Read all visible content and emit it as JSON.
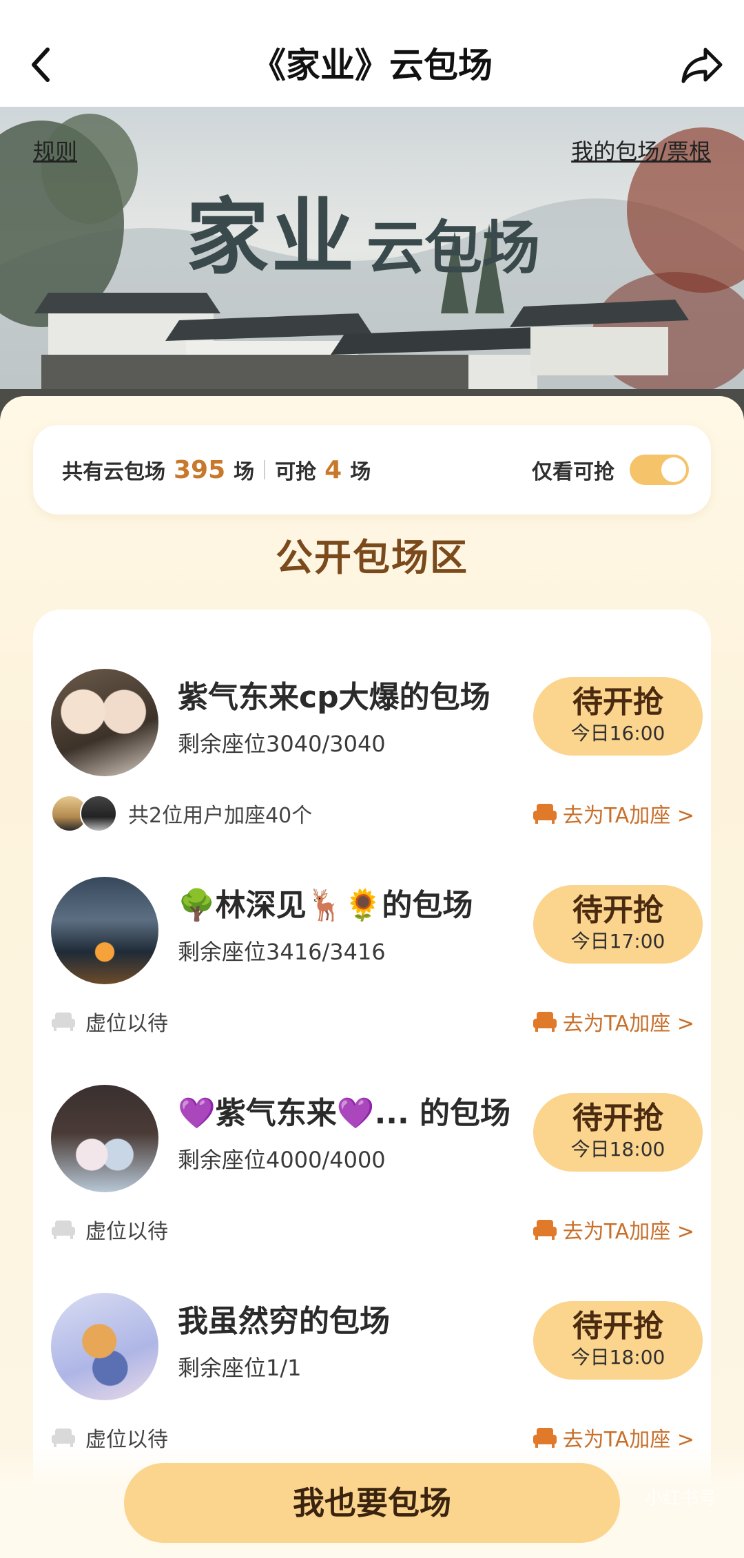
{
  "header": {
    "title": "《家业》云包场"
  },
  "banner": {
    "rules_link": "规则",
    "my_link": "我的包场/票根",
    "title_big": "家业",
    "title_small": "云包场"
  },
  "summary": {
    "total_label": "共有云包场",
    "total_count": "395",
    "total_unit": "场",
    "available_label": "可抢",
    "available_count": "4",
    "available_unit": "场",
    "filter_label": "仅看可抢",
    "filter_on": true
  },
  "section": {
    "title": "公开包场区"
  },
  "items": [
    {
      "title": "紫气东来cp大爆的包场",
      "seats": "剩余座位3040/3040",
      "button_label": "待开抢",
      "time": "今日16:00",
      "footer_left": "共2位用户加座40个",
      "footer_right": "去为TA加座 >"
    },
    {
      "title": "🌳林深见🦌🌻的包场",
      "seats": "剩余座位3416/3416",
      "button_label": "待开抢",
      "time": "今日17:00",
      "footer_left": "虚位以待",
      "footer_right": "去为TA加座 >"
    },
    {
      "title": "💜紫气东来💜...  的包场",
      "seats": "剩余座位4000/4000",
      "button_label": "待开抢",
      "time": "今日18:00",
      "footer_left": "虚位以待",
      "footer_right": "去为TA加座 >"
    },
    {
      "title": "我虽然穷的包场",
      "seats": "剩余座位1/1",
      "button_label": "待开抢",
      "time": "今日18:00",
      "footer_left": "虚位以待",
      "footer_right": "去为TA加座 >"
    }
  ],
  "cta": {
    "label": "我也要包场"
  },
  "watermark": "小红书号",
  "colors": {
    "accent_orange": "#c8782a",
    "button_yellow": "#fbd48d",
    "section_brown": "#7b4a1c",
    "toggle_on": "#f5c46a"
  }
}
